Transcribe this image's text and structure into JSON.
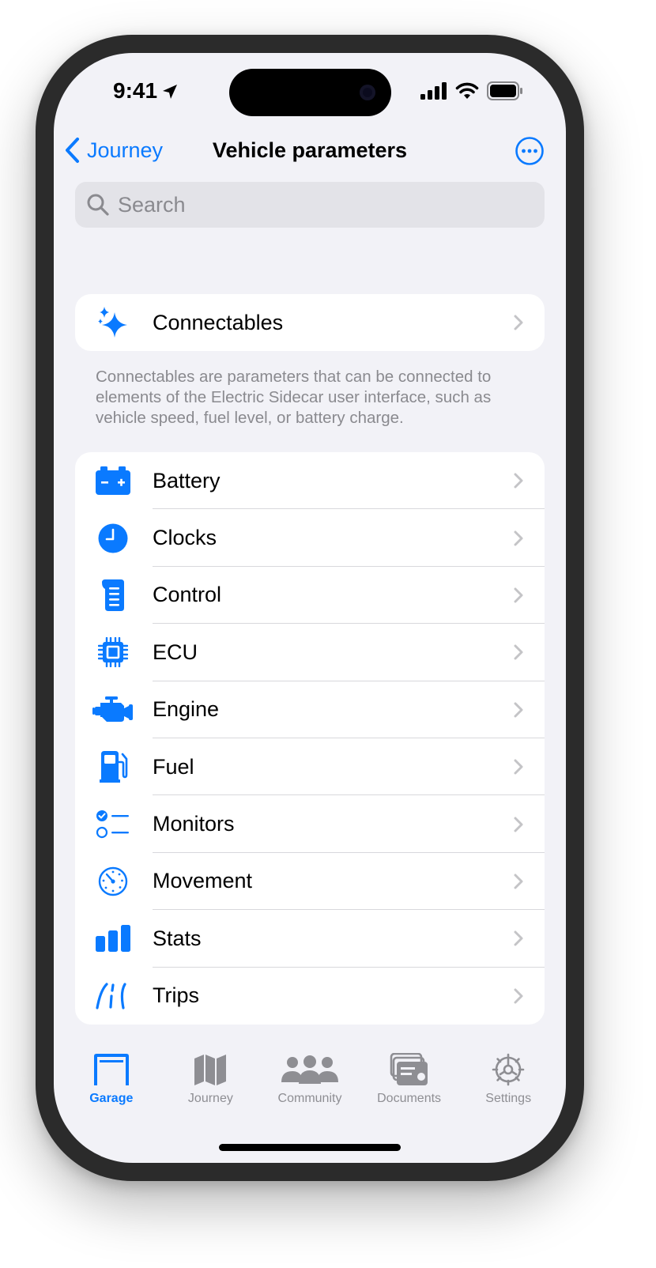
{
  "status_bar": {
    "time": "9:41"
  },
  "nav": {
    "back_label": "Journey",
    "title": "Vehicle parameters"
  },
  "search": {
    "placeholder": "Search"
  },
  "connectables": {
    "label": "Connectables",
    "footnote": "Connectables are parameters that can be connected to elements of the Electric Sidecar user interface, such as vehicle speed, fuel level, or battery charge."
  },
  "parameters": [
    {
      "label": "Battery",
      "icon": "battery-icon"
    },
    {
      "label": "Clocks",
      "icon": "clock-icon"
    },
    {
      "label": "Control",
      "icon": "control-icon"
    },
    {
      "label": "ECU",
      "icon": "cpu-icon"
    },
    {
      "label": "Engine",
      "icon": "engine-icon"
    },
    {
      "label": "Fuel",
      "icon": "fuel-pump-icon"
    },
    {
      "label": "Monitors",
      "icon": "checklist-icon"
    },
    {
      "label": "Movement",
      "icon": "gauge-icon"
    },
    {
      "label": "Stats",
      "icon": "bar-chart-icon"
    },
    {
      "label": "Trips",
      "icon": "road-icon"
    }
  ],
  "tabs": [
    {
      "label": "Garage",
      "icon": "garage-icon",
      "active": true
    },
    {
      "label": "Journey",
      "icon": "map-icon",
      "active": false
    },
    {
      "label": "Community",
      "icon": "people-icon",
      "active": false
    },
    {
      "label": "Documents",
      "icon": "documents-icon",
      "active": false
    },
    {
      "label": "Settings",
      "icon": "gear-icon",
      "active": false
    }
  ],
  "colors": {
    "accent": "#0a7aff",
    "background": "#f2f2f7",
    "inactive_tab": "#8e8e93"
  }
}
